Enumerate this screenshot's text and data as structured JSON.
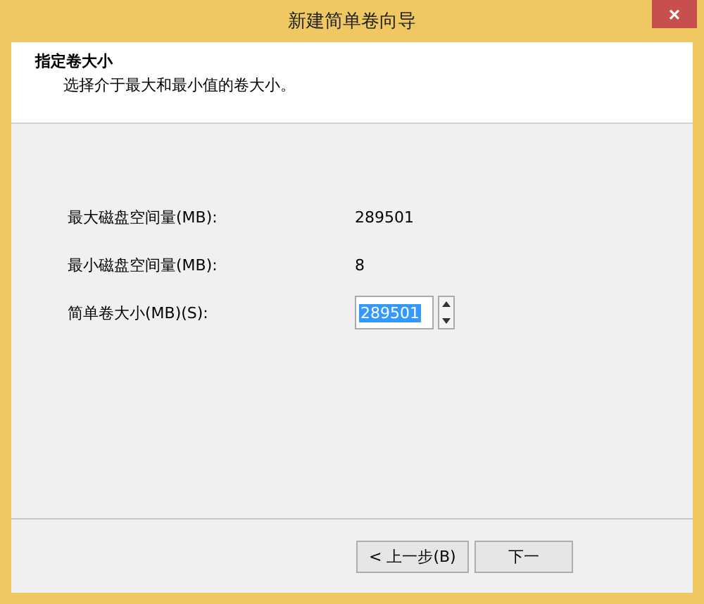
{
  "window": {
    "title": "新建简单卷向导",
    "close": "×"
  },
  "header": {
    "title": "指定卷大小",
    "subtitle": "选择介于最大和最小值的卷大小。"
  },
  "fields": [
    {
      "kind": "readout",
      "label": "最大磁盘空间量(MB):",
      "value": "289501"
    },
    {
      "kind": "readout",
      "label": "最小磁盘空间量(MB):",
      "value": "8"
    },
    {
      "kind": "spin",
      "label": "简单卷大小(MB)(S):",
      "value": "289501",
      "selected": true
    }
  ],
  "buttons": [
    {
      "label": "< 上一步(B)"
    },
    {
      "label": "下一"
    }
  ]
}
